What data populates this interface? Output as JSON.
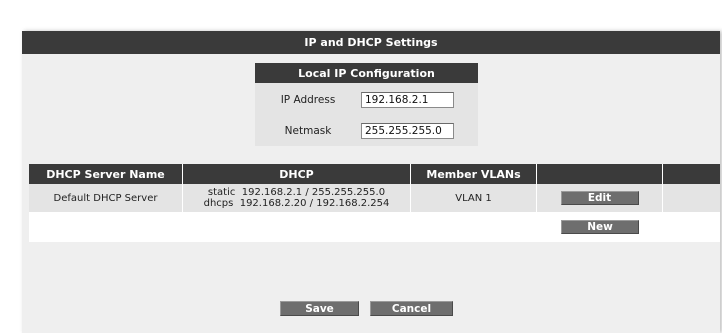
{
  "title": "IP and DHCP Settings",
  "local_ip": {
    "header": "Local IP Configuration",
    "ip_label": "IP Address",
    "ip_value": "192.168.2.1",
    "netmask_label": "Netmask",
    "netmask_value": "255.255.255.0"
  },
  "table": {
    "columns": [
      "DHCP Server Name",
      "DHCP",
      "Member VLANs"
    ],
    "rows": [
      {
        "name": "Default DHCP Server",
        "dhcp_line1": "static  192.168.2.1 / 255.255.255.0",
        "dhcp_line2": "dhcps  192.168.2.20 / 192.168.2.254",
        "vlans": "VLAN 1",
        "edit_label": "Edit"
      }
    ],
    "new_label": "New"
  },
  "actions": {
    "save_label": "Save",
    "cancel_label": "Cancel"
  },
  "colors": {
    "header_bg": "#3a3a3a",
    "panel_bg": "#efefef",
    "button_bg": "#6e6e6e"
  }
}
